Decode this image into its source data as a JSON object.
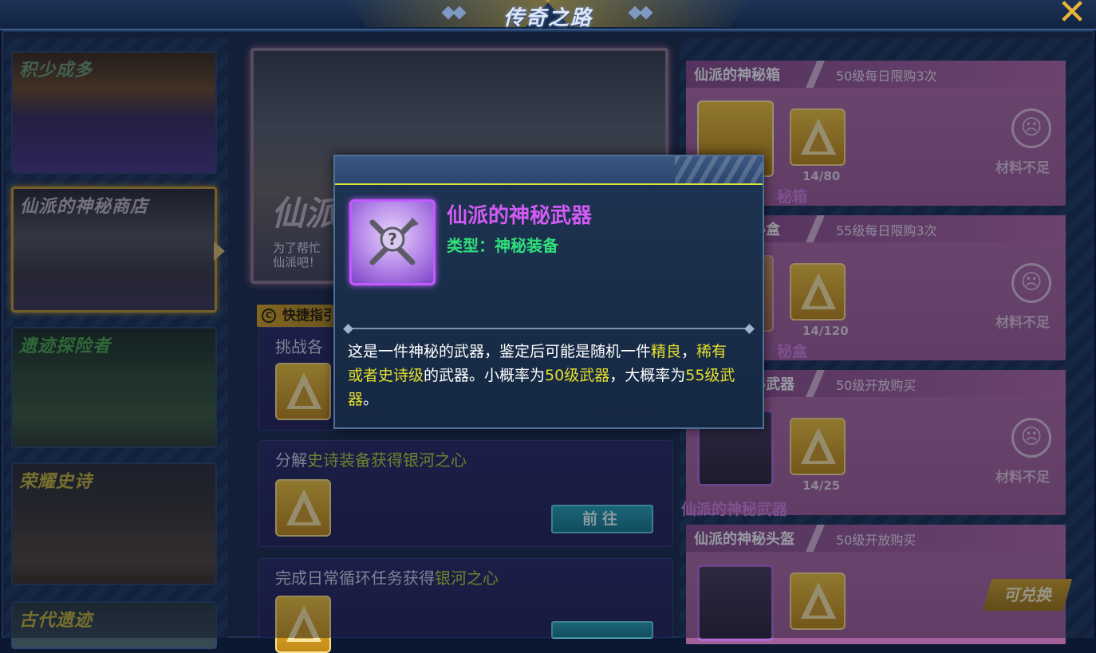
{
  "header": {
    "title": "传奇之路"
  },
  "left_nav": {
    "items": [
      {
        "label": "积少成多",
        "label_color": "#6e9a78"
      },
      {
        "label": "仙派的神秘商店",
        "label_color": "#b7a8b5"
      },
      {
        "label": "遗迹探险者",
        "label_color": "#4fa84a"
      },
      {
        "label": "荣耀史诗",
        "label_color": "#c9b53a"
      },
      {
        "label": "古代遗迹",
        "label_color": "#c9b53a"
      }
    ]
  },
  "banner": {
    "big_text": "仙派",
    "sub_line1": "为了帮忙",
    "sub_line2": "仙派吧！",
    "sub_right": "秘"
  },
  "guide": {
    "tag_label": "快捷指引",
    "circle_letter": "C"
  },
  "tasks": [
    {
      "title": "挑战各",
      "title_hl": "",
      "title_suffix": "",
      "button": ""
    },
    {
      "title": "分解",
      "title_hl": "史诗装备获得银河之心",
      "title_suffix": "",
      "button": "前往"
    },
    {
      "title": "完成日常循环任务获得",
      "title_hl": "银河之心",
      "title_suffix": "",
      "button": ""
    }
  ],
  "shop": {
    "items": [
      {
        "name": "仙派的神秘箱",
        "limit": "50级每日限购3次",
        "count": "14/80",
        "status": "材料不足",
        "caption": "仙派的神秘箱",
        "caption_visible": "秘箱"
      },
      {
        "name": "仙派的神秘盒",
        "limit": "55级每日限购3次",
        "count": "14/120",
        "status": "材料不足",
        "caption": "仙派的神秘盒",
        "caption_visible": "秘盒"
      },
      {
        "name": "仙派的神秘武器",
        "limit": "50级开放购买",
        "count": "14/25",
        "status": "材料不足",
        "caption": "仙派的神秘武器",
        "caption_visible": "仙派的神秘武器"
      },
      {
        "name": "仙派的神秘头盔",
        "limit": "50级开放购买",
        "count": "",
        "status": "",
        "caption": "",
        "caption_visible": ""
      }
    ],
    "redeem_button": "可兑换"
  },
  "tooltip": {
    "name": "仙派的神秘武器",
    "type": "类型：神秘装备",
    "desc": [
      {
        "t": "这是一件神秘的武器，鉴定后可能是随机一件",
        "hl": false
      },
      {
        "t": "精良",
        "hl": true
      },
      {
        "t": "，",
        "hl": false
      },
      {
        "t": "稀有或者史诗级",
        "hl": true
      },
      {
        "t": "的武器。小概率为",
        "hl": false
      },
      {
        "t": "50级武器",
        "hl": true
      },
      {
        "t": "，大概率为",
        "hl": false
      },
      {
        "t": "55级武器",
        "hl": true
      },
      {
        "t": "。",
        "hl": false
      }
    ]
  },
  "colors": {
    "accent_gold": "#c49a2e",
    "tooltip_name": "#d35bf5",
    "tooltip_type": "#2fe07b",
    "highlight_yellow": "#e6df2b",
    "task_highlight": "#b2d83a",
    "shop_card": "#b46da6"
  }
}
